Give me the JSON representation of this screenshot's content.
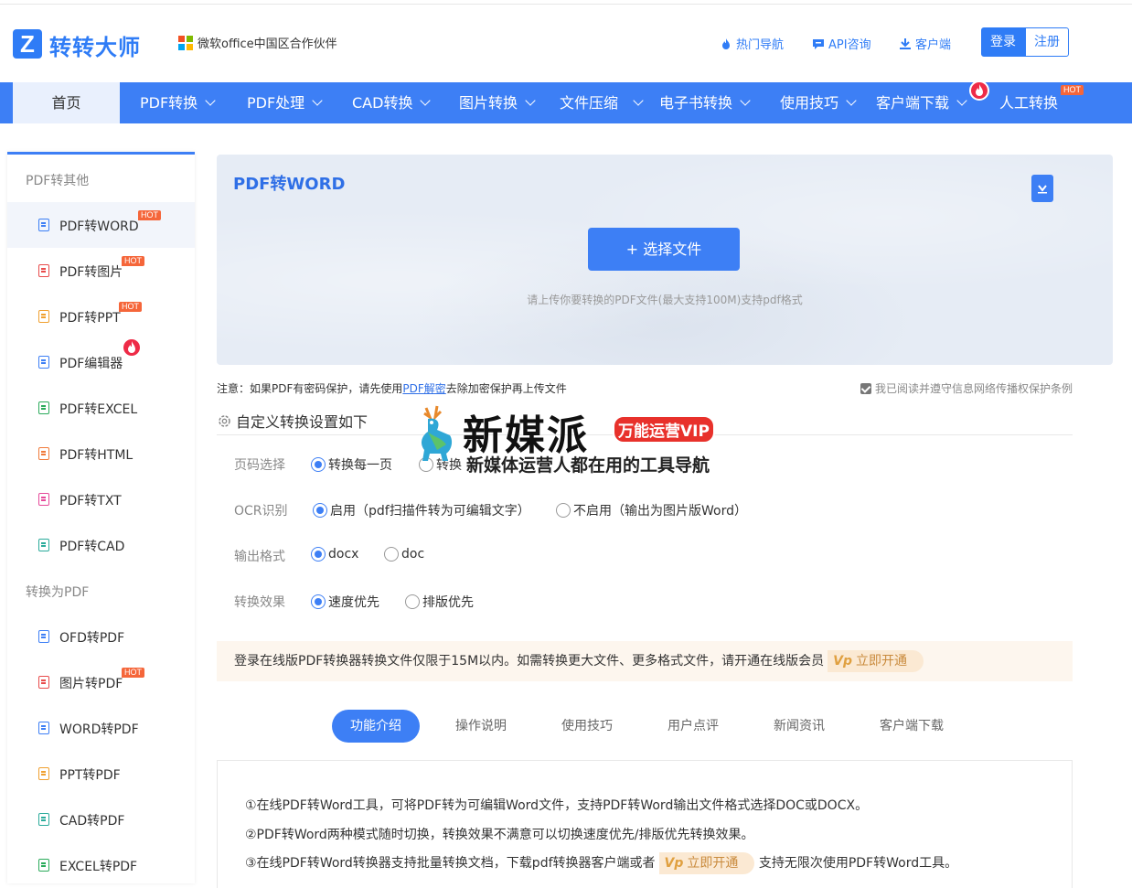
{
  "header": {
    "logo_mark": "Z",
    "logo_text": "转转大师",
    "partner": "微软office中国区合作伙伴",
    "links": [
      "热门导航",
      "API咨询",
      "客户端"
    ],
    "login": "登录",
    "register": "注册"
  },
  "nav": {
    "home": "首页",
    "items": [
      "PDF转换",
      "PDF处理",
      "CAD转换",
      "图片转换",
      "文件压缩",
      "电子书转换",
      "使用技巧",
      "客户端下载",
      "人工转换"
    ],
    "hot": "HOT"
  },
  "sidebar": {
    "section1": "PDF转其他",
    "items1": [
      "PDF转WORD",
      "PDF转图片",
      "PDF转PPT",
      "PDF编辑器",
      "PDF转EXCEL",
      "PDF转HTML",
      "PDF转TXT",
      "PDF转CAD"
    ],
    "section2": "转换为PDF",
    "items2": [
      "OFD转PDF",
      "图片转PDF",
      "WORD转PDF",
      "PPT转PDF",
      "CAD转PDF",
      "EXCEL转PDF"
    ],
    "hot": "HOT"
  },
  "upload": {
    "title": "PDF转WORD",
    "button": "+ 选择文件",
    "hint": "请上传你要转换的PDF文件(最大支持100M)支持pdf格式"
  },
  "note": {
    "prefix": "注意：如果PDF有密码保护，请先使用",
    "link": "PDF解密",
    "suffix": "去除加密保护再上传文件",
    "agree": "我已阅读并遵守信息网络传播权保护条例"
  },
  "settings": {
    "title": "自定义转换设置如下",
    "rows": [
      {
        "label": "页码选择",
        "options": [
          "转换每一页",
          "转换"
        ]
      },
      {
        "label": "OCR识别",
        "options": [
          "启用（pdf扫描件转为可编辑文字）",
          "不启用（输出为图片版Word）"
        ]
      },
      {
        "label": "输出格式",
        "options": [
          "docx",
          "doc"
        ]
      },
      {
        "label": "转换效果",
        "options": [
          "速度优先",
          "排版优先"
        ]
      }
    ]
  },
  "vip": {
    "text": "登录在线版PDF转换器转换文件仅限于15M以内。如需转换更大文件、更多格式文件，请开通在线版会员",
    "link": "立即开通"
  },
  "tabs": [
    "功能介绍",
    "操作说明",
    "使用技巧",
    "用户点评",
    "新闻资讯",
    "客户端下载"
  ],
  "intro": {
    "line1": "①在线PDF转Word工具，可将PDF转为可编辑Word文件，支持PDF转Word输出文件格式选择DOC或DOCX。",
    "line2": "②PDF转Word两种模式随时切换，转换效果不满意可以切换速度优先/排版优先转换效果。",
    "line3a": "③在线PDF转Word转换器支持批量转换文档，下载pdf转换器客户端或者",
    "line3link": "立即开通",
    "line3b": "支持无限次使用PDF转Word工具。"
  },
  "watermark": {
    "title": "新媒派",
    "badge": "万能运营VIP",
    "sub": "新媒体运营人都在用的工具导航"
  },
  "colors": {
    "primary": "#3d7ff5",
    "hot": "#f5663a",
    "fire": "#ee2b47"
  }
}
